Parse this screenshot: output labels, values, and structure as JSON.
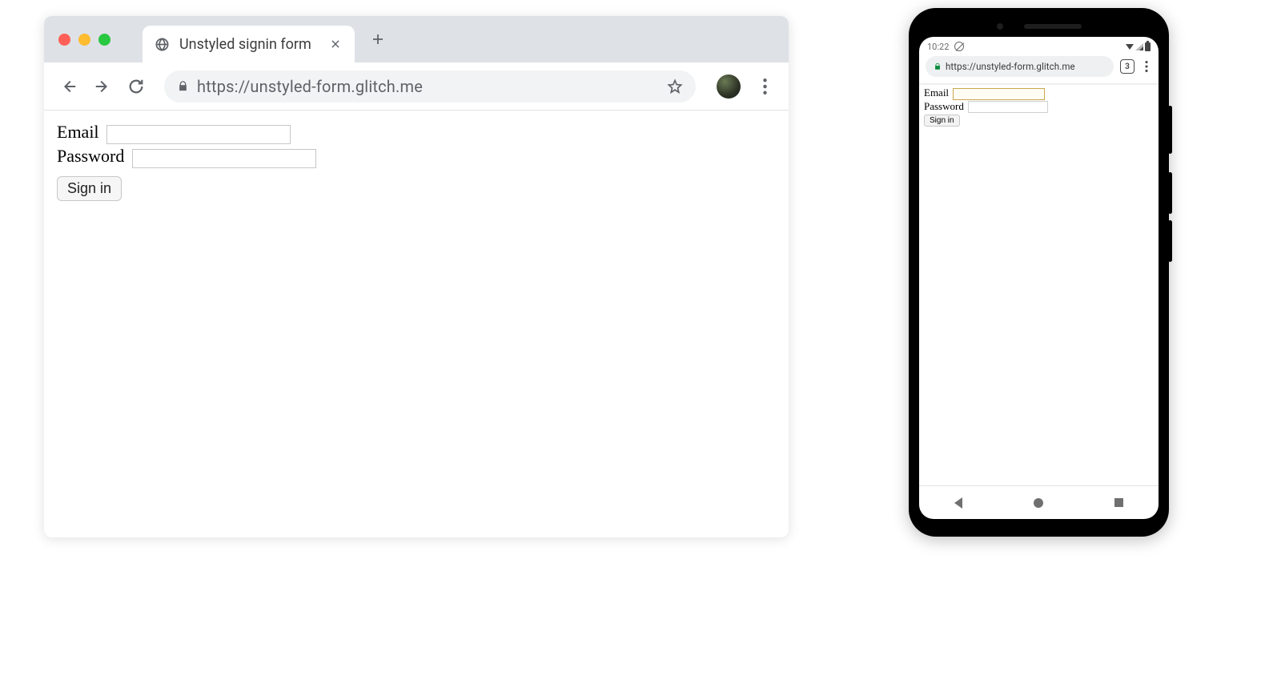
{
  "desktop": {
    "tab_title": "Unstyled signin form",
    "url": "https://unstyled-form.glitch.me",
    "form": {
      "email_label": "Email",
      "password_label": "Password",
      "signin_label": "Sign in"
    }
  },
  "mobile": {
    "status": {
      "time": "10:22",
      "tab_count": "3"
    },
    "url": "https://unstyled-form.glitch.me",
    "form": {
      "email_label": "Email",
      "password_label": "Password",
      "signin_label": "Sign in"
    }
  }
}
